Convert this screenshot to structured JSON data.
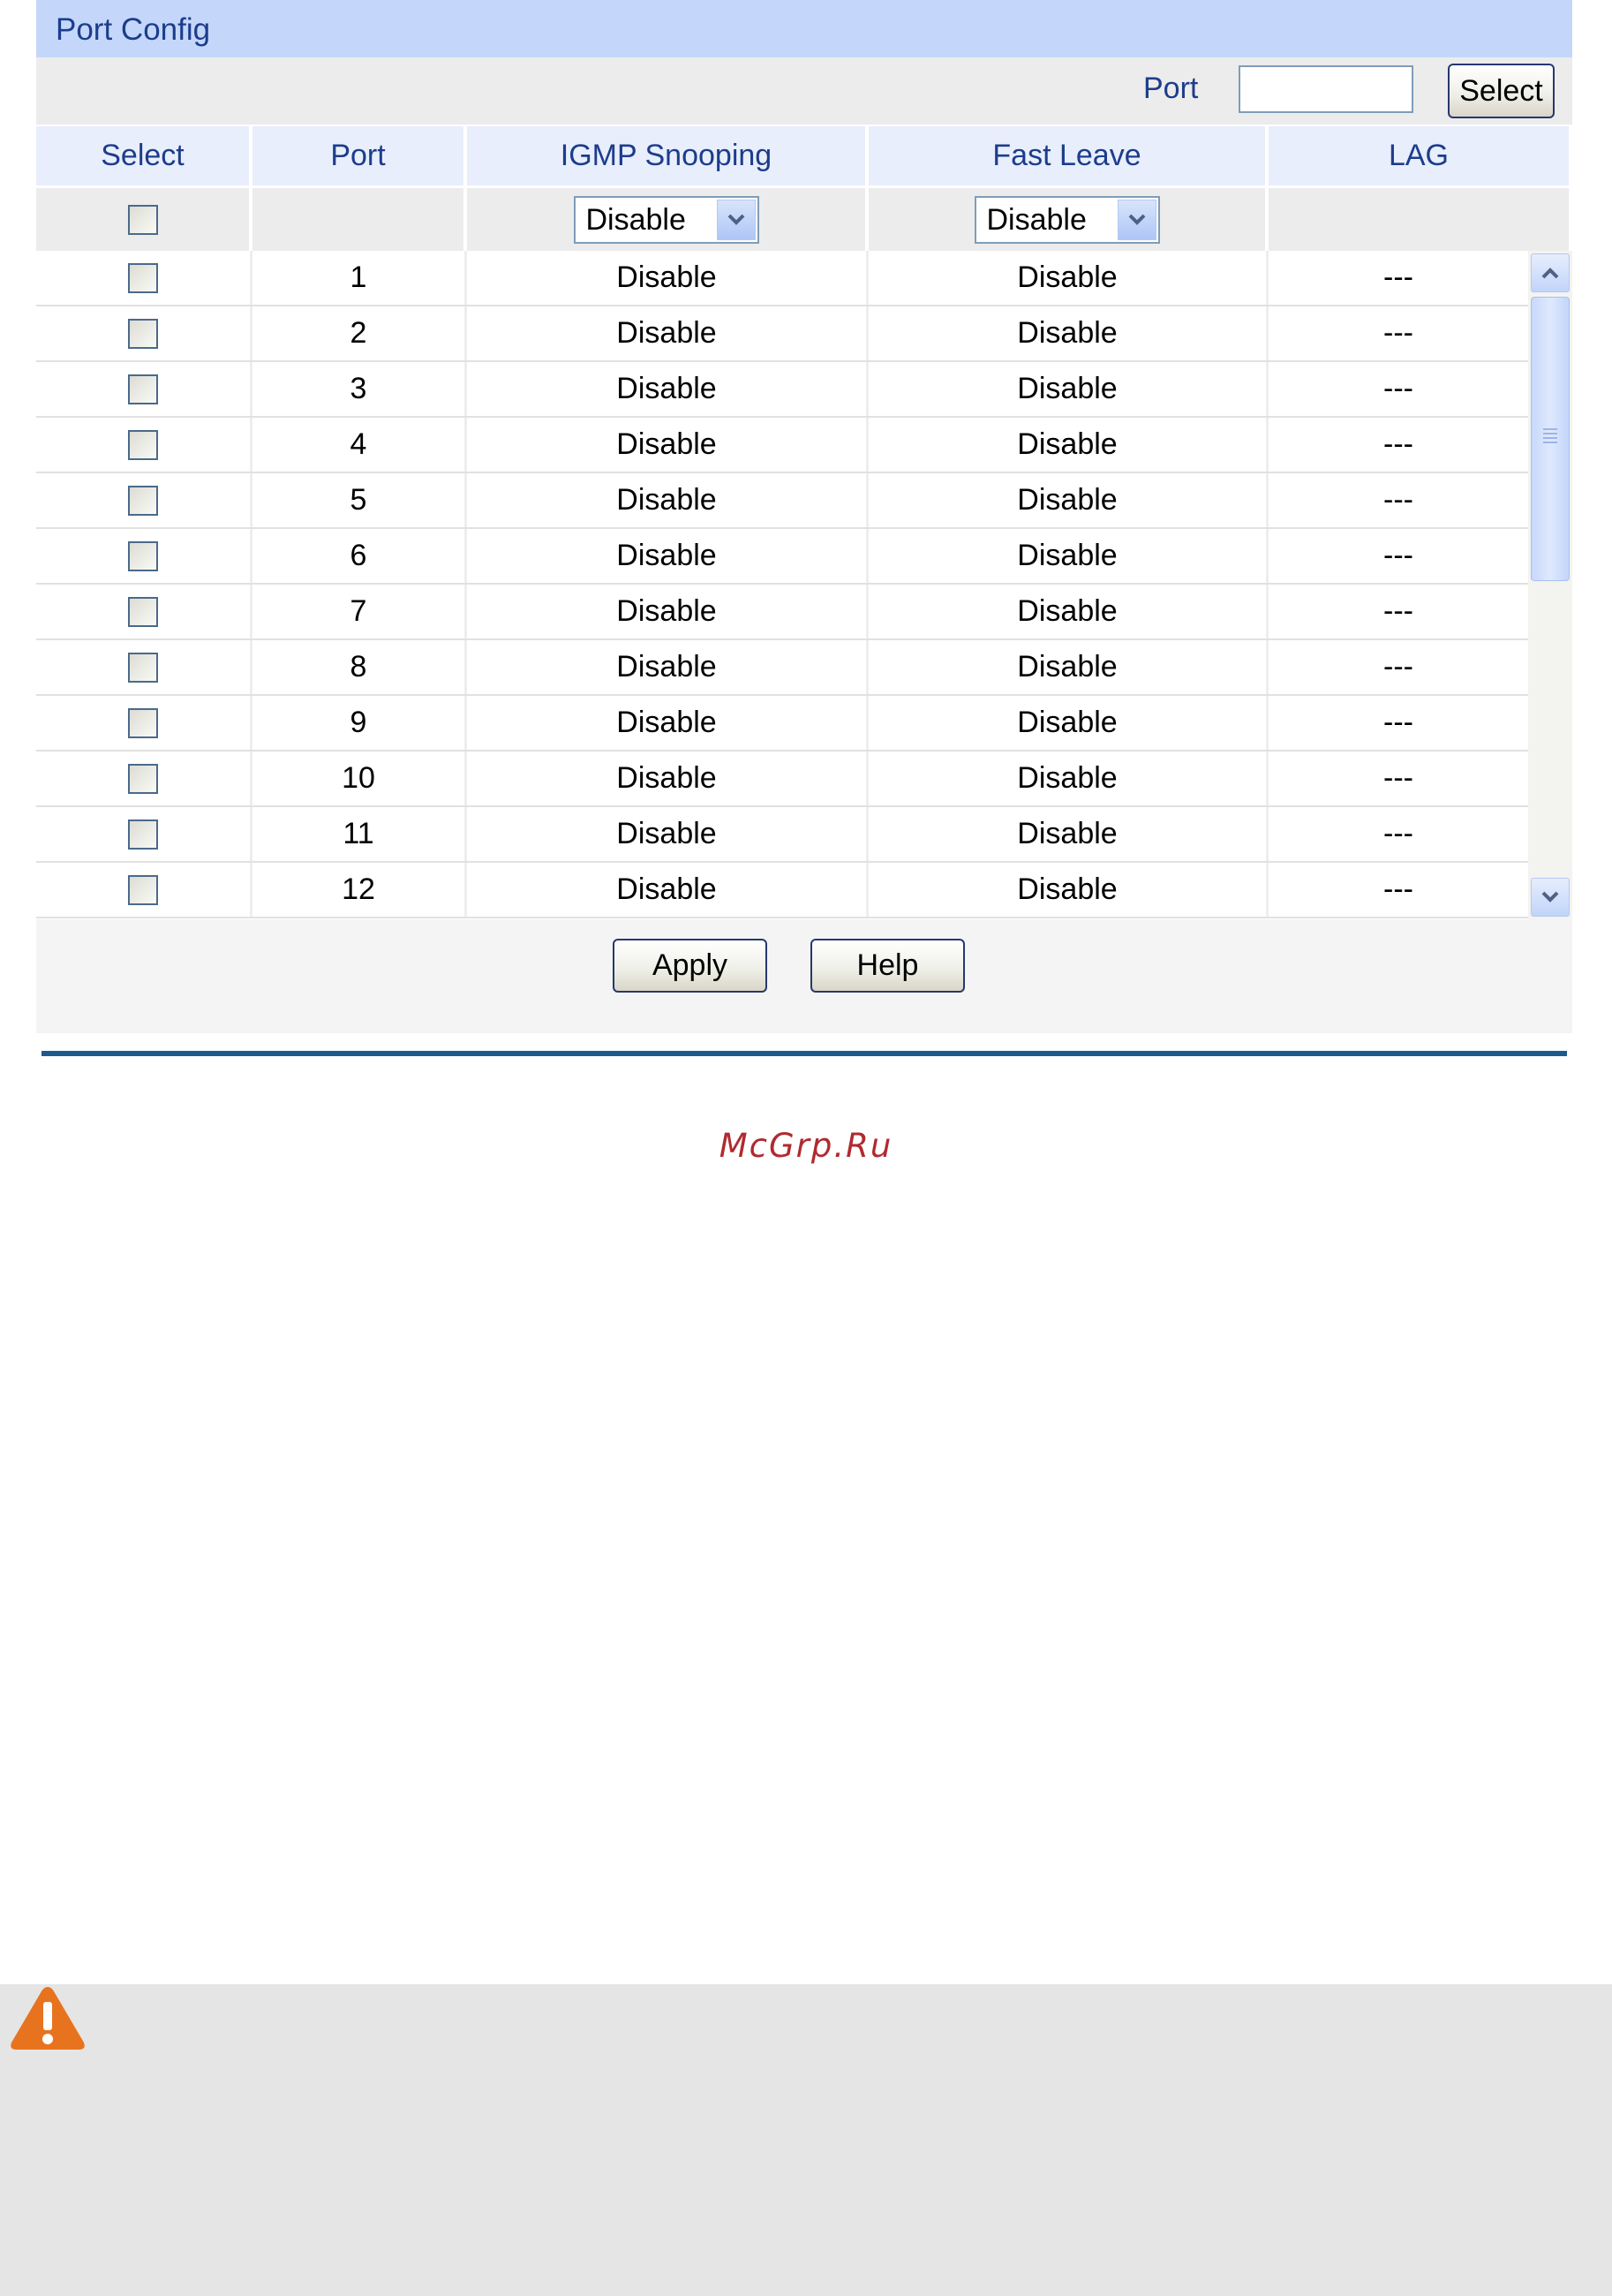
{
  "panel": {
    "title": "Port Config"
  },
  "port_search": {
    "label": "Port",
    "value": "",
    "select_label": "Select"
  },
  "table": {
    "headers": {
      "select": "Select",
      "port": "Port",
      "igmp": "IGMP Snooping",
      "fast_leave": "Fast Leave",
      "lag": "LAG"
    },
    "bulk": {
      "igmp_value": "Disable",
      "fast_leave_value": "Disable"
    },
    "rows": [
      {
        "port": "1",
        "igmp": "Disable",
        "fast_leave": "Disable",
        "lag": "---"
      },
      {
        "port": "2",
        "igmp": "Disable",
        "fast_leave": "Disable",
        "lag": "---"
      },
      {
        "port": "3",
        "igmp": "Disable",
        "fast_leave": "Disable",
        "lag": "---"
      },
      {
        "port": "4",
        "igmp": "Disable",
        "fast_leave": "Disable",
        "lag": "---"
      },
      {
        "port": "5",
        "igmp": "Disable",
        "fast_leave": "Disable",
        "lag": "---"
      },
      {
        "port": "6",
        "igmp": "Disable",
        "fast_leave": "Disable",
        "lag": "---"
      },
      {
        "port": "7",
        "igmp": "Disable",
        "fast_leave": "Disable",
        "lag": "---"
      },
      {
        "port": "8",
        "igmp": "Disable",
        "fast_leave": "Disable",
        "lag": "---"
      },
      {
        "port": "9",
        "igmp": "Disable",
        "fast_leave": "Disable",
        "lag": "---"
      },
      {
        "port": "10",
        "igmp": "Disable",
        "fast_leave": "Disable",
        "lag": "---"
      },
      {
        "port": "11",
        "igmp": "Disable",
        "fast_leave": "Disable",
        "lag": "---"
      },
      {
        "port": "12",
        "igmp": "Disable",
        "fast_leave": "Disable",
        "lag": "---"
      }
    ]
  },
  "buttons": {
    "apply": "Apply",
    "help": "Help"
  },
  "watermark": "McGrp.Ru",
  "icons": {
    "warning": "warning-icon",
    "dropdown": "chevron-down-icon",
    "scroll_up": "chevron-up-icon",
    "scroll_down": "chevron-down-icon"
  },
  "colors": {
    "header_bg": "#c4d7fa",
    "header_text": "#1c3d8c",
    "divider": "#1c5a8e",
    "watermark": "#b02a30",
    "warning": "#e8731e"
  }
}
